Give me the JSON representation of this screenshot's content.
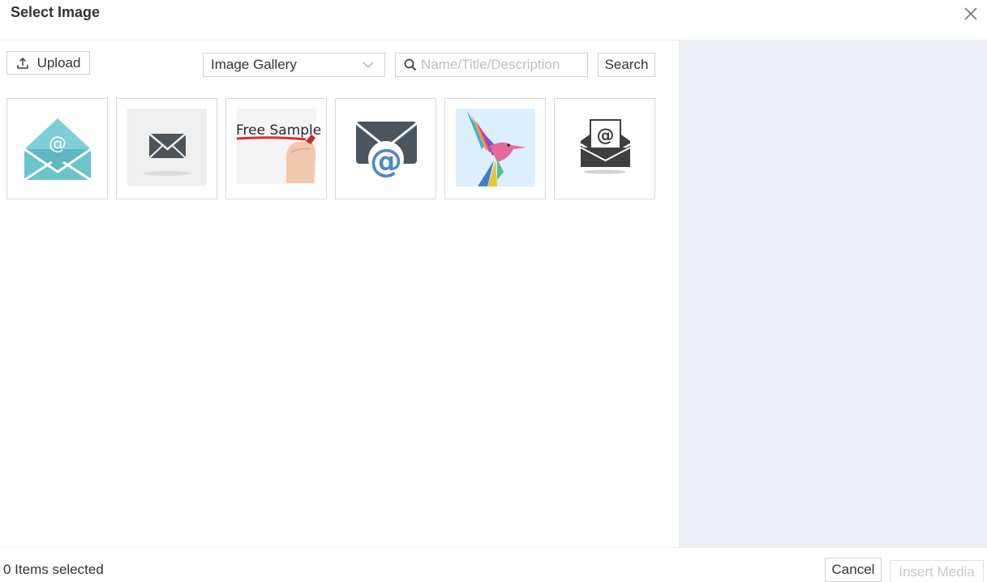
{
  "dialog": {
    "title": "Select Image",
    "close_icon": "close-icon"
  },
  "toolbar": {
    "upload_label": "Upload",
    "upload_icon": "upload-icon",
    "gallery_selected": "Image Gallery",
    "search_placeholder": "Name/Title/Description",
    "search_value": "",
    "search_label": "Search"
  },
  "thumbnails": [
    {
      "icon": "open-envelope-at-icon",
      "accent": "#6cc3cb"
    },
    {
      "icon": "envelope-icon",
      "accent": "#4d5358"
    },
    {
      "icon": "free-sample-photo",
      "text": "Free Sample",
      "accent": "#d9302c"
    },
    {
      "icon": "envelope-at-icon",
      "accent": "#4b5560"
    },
    {
      "icon": "hummingbird-icon",
      "accent": "#e04b8c"
    },
    {
      "icon": "envelope-letter-at-icon",
      "accent": "#3f3f3f"
    }
  ],
  "footer": {
    "selected_text": "0 Items selected",
    "cancel_label": "Cancel",
    "insert_label": "Insert Media"
  }
}
